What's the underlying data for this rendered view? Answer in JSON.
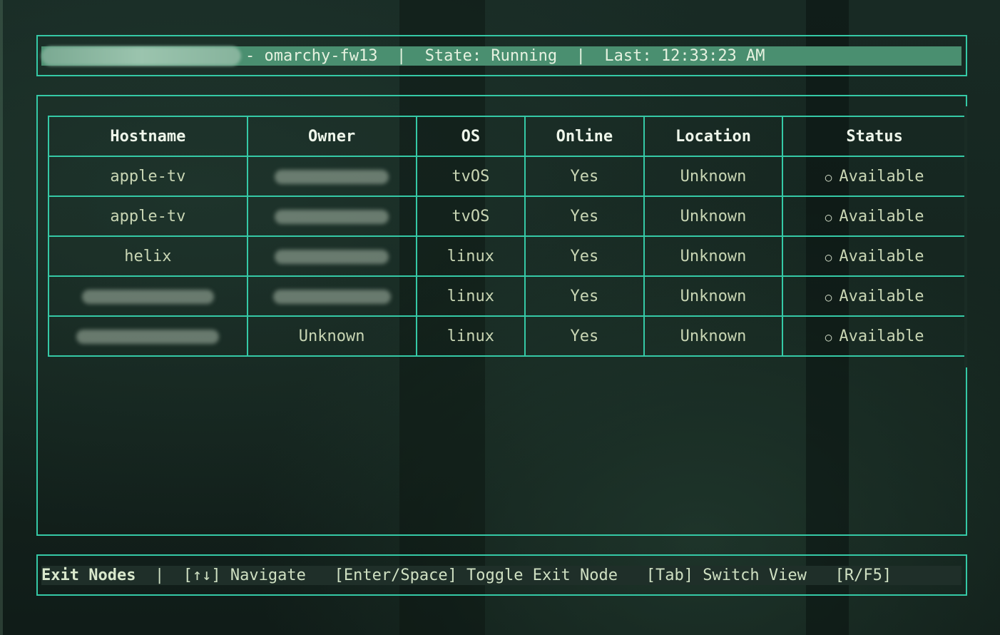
{
  "header": {
    "user": "████████@gmail.com",
    "device_sep": "- ",
    "device": "omarchy-fw13",
    "divider": "  |  ",
    "state_label": "State: ",
    "state": "Running",
    "last_label": "Last: ",
    "last_time": "12:33:23 AM"
  },
  "table": {
    "columns": [
      "Hostname",
      "Owner",
      "OS",
      "Online",
      "Location",
      "Status"
    ],
    "rows": [
      {
        "hostname": "apple-tv",
        "owner": "",
        "os": "tvOS",
        "online": "Yes",
        "location": "Unknown",
        "status": "Available"
      },
      {
        "hostname": "apple-tv",
        "owner": "",
        "os": "tvOS",
        "online": "Yes",
        "location": "Unknown",
        "status": "Available"
      },
      {
        "hostname": "helix",
        "owner": "",
        "os": "linux",
        "online": "Yes",
        "location": "Unknown",
        "status": "Available"
      },
      {
        "hostname": "",
        "owner": "",
        "os": "linux",
        "online": "Yes",
        "location": "Unknown",
        "status": "Available"
      },
      {
        "hostname": "",
        "owner": "Unknown",
        "os": "linux",
        "online": "Yes",
        "location": "Unknown",
        "status": "Available"
      }
    ],
    "status_icon": "circle-outline-icon"
  },
  "footer": {
    "mode": "Exit Nodes",
    "sep": "  |  ",
    "nav": "[↑↓] Navigate",
    "toggle": "[Enter/Space] Toggle Exit Node",
    "switch": "[Tab] Switch View",
    "refresh": "[R/F5]"
  },
  "colors": {
    "border": "#35c9a6",
    "header_bar": "#4a8f70",
    "footer_bar": "#1f2f29"
  }
}
